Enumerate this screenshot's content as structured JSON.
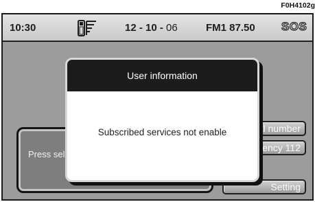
{
  "figure_code": "F0H4102g",
  "status_bar": {
    "time": "10:30",
    "date_day_month": "12 - 10 - ",
    "date_year": "06",
    "radio": "FM1 87.50",
    "sos": "SOS",
    "phone_icon": "phone-signal-icon"
  },
  "background_dialog": {
    "text": "Press sele"
  },
  "side_buttons": {
    "personal_number": "nal number",
    "emergency": "gency 112",
    "setting": "Setting"
  },
  "popup": {
    "title": "User information",
    "message": "Subscribed services not enable"
  }
}
